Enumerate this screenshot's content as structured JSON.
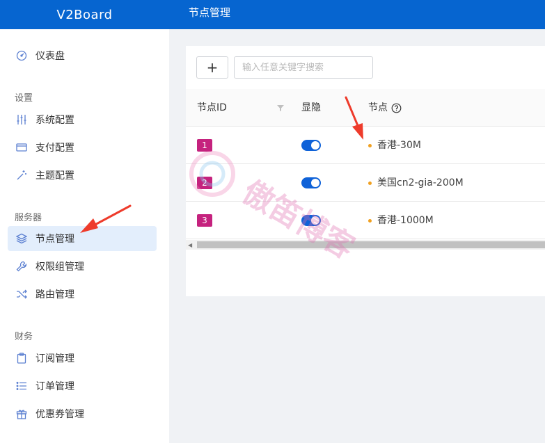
{
  "brand": {
    "title": "V2Board"
  },
  "header": {
    "page_title": "节点管理"
  },
  "sidebar": {
    "items": [
      {
        "label": "仪表盘",
        "icon": "dashboard-icon"
      },
      {
        "section": "设置"
      },
      {
        "label": "系统配置",
        "icon": "sliders-icon"
      },
      {
        "label": "支付配置",
        "icon": "credit-card-icon"
      },
      {
        "label": "主题配置",
        "icon": "magic-wand-icon"
      },
      {
        "section": "服务器"
      },
      {
        "label": "节点管理",
        "icon": "layers-icon",
        "active": true
      },
      {
        "label": "权限组管理",
        "icon": "wrench-icon"
      },
      {
        "label": "路由管理",
        "icon": "shuffle-icon"
      },
      {
        "section": "财务"
      },
      {
        "label": "订阅管理",
        "icon": "clipboard-icon"
      },
      {
        "label": "订单管理",
        "icon": "list-icon"
      },
      {
        "label": "优惠券管理",
        "icon": "gift-icon"
      }
    ]
  },
  "toolbar": {
    "add_label": "+",
    "search_placeholder": "输入任意关键字搜索"
  },
  "table": {
    "headers": {
      "id": "节点ID",
      "show": "显隐",
      "node": "节点"
    },
    "rows": [
      {
        "id": "1",
        "visible": true,
        "name": "香港-30M"
      },
      {
        "id": "2",
        "visible": true,
        "name": "美国cn2-gia-200M"
      },
      {
        "id": "3",
        "visible": true,
        "name": "香港-1000M"
      }
    ]
  },
  "watermark": {
    "text": "傲笛博客"
  },
  "colors": {
    "brand_blue": "#0665d0",
    "badge_magenta": "#c5227e",
    "status_dot": "#f0a020",
    "annotation_arrow": "#ee3b2b"
  }
}
